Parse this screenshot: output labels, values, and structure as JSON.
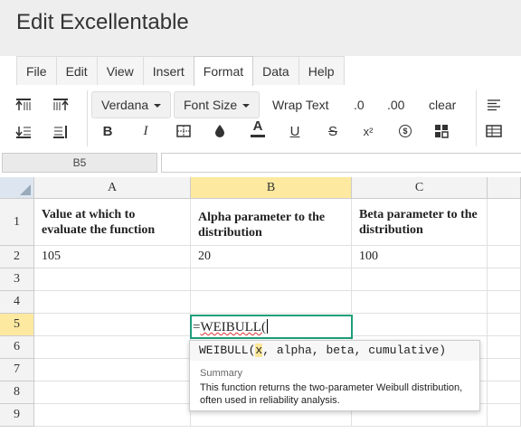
{
  "app": {
    "title": "Edit Excellentable"
  },
  "menu": {
    "tabs": [
      "File",
      "Edit",
      "View",
      "Insert",
      "Format",
      "Data",
      "Help"
    ],
    "active": "Format"
  },
  "toolbar": {
    "font_family": "Verdana",
    "font_size": "Font Size",
    "wrap_text": "Wrap Text",
    "decrease_decimal": ".0",
    "increase_decimal": ".00",
    "clear": "clear",
    "icons": [
      "align-top-icon",
      "align-middle-icon",
      "align-bottom-icon",
      "align-bottom-alt-icon",
      "bold-icon",
      "italic-icon",
      "border-icon",
      "fill-color-icon",
      "font-color-icon",
      "underline-icon",
      "strikethrough-icon",
      "superscript-icon",
      "currency-icon",
      "merge-cells-icon",
      "align-left-icon",
      "table-icon"
    ],
    "bold_glyph": "B",
    "italic_glyph": "I",
    "font_color_glyph": "A",
    "underline_glyph": "U",
    "strike_glyph": "S",
    "superscript_glyph": "x²",
    "currency_glyph": "$"
  },
  "formula_bar": {
    "cell_ref": "B5",
    "value": ""
  },
  "sheet": {
    "columns": [
      "A",
      "B",
      "C"
    ],
    "rows": [
      "1",
      "2",
      "3",
      "4",
      "5",
      "6",
      "7",
      "8",
      "9"
    ],
    "selected_column": "B",
    "selected_row": "5",
    "cells": {
      "A1": "Value at which to evaluate the function",
      "B1": "Alpha parameter to the distribution",
      "C1": "Beta parameter to the distribution",
      "A2": "105",
      "B2": "20",
      "C2": "100"
    },
    "editing": {
      "cell": "B5",
      "prefix": "=",
      "text": "WEIBULL("
    }
  },
  "autocomplete": {
    "function": "WEIBULL(",
    "arg_active": "x",
    "args_rest": ", alpha, beta, cumulative)",
    "summary_label": "Summary",
    "description": "This function returns the two-parameter Weibull distribution, often used in reliability analysis."
  },
  "colors": {
    "accent": "#1e9e7b",
    "selection": "#fde9a0",
    "highlight": "#fce79a"
  }
}
